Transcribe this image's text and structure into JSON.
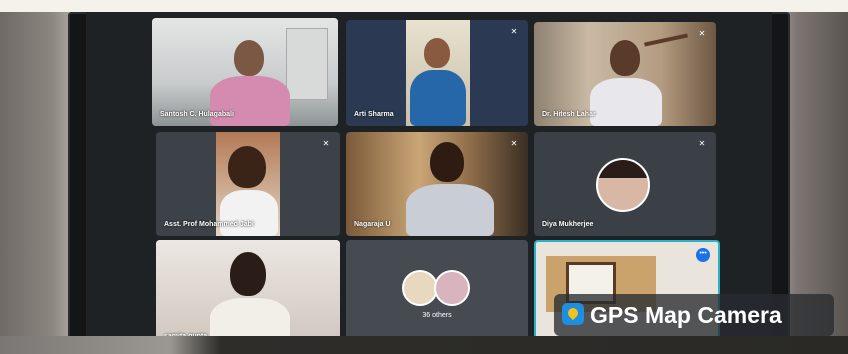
{
  "participants": [
    {
      "name": "Santosh C. Hulagabali",
      "muted": false
    },
    {
      "name": "Arti Sharma",
      "muted": true
    },
    {
      "name": "Dr. Hitesh Lahar",
      "muted": true
    },
    {
      "name": "Asst. Prof Mohammed Jabi",
      "muted": true
    },
    {
      "name": "Nagaraja U",
      "muted": true
    },
    {
      "name": "Diya Mukherjee",
      "muted": true
    },
    {
      "name": "samita gupta",
      "muted": false
    },
    {
      "name": "36 others",
      "muted": false
    }
  ],
  "watermark": {
    "label": "GPS Map Camera",
    "icon": "map-pin-icon"
  },
  "icons": {
    "mute": "microphone-off-icon",
    "more": "more-options-icon"
  },
  "colors": {
    "tile_bg": "#3b4046",
    "screen_bg": "#1f2225",
    "accent": "#1a73e8"
  }
}
